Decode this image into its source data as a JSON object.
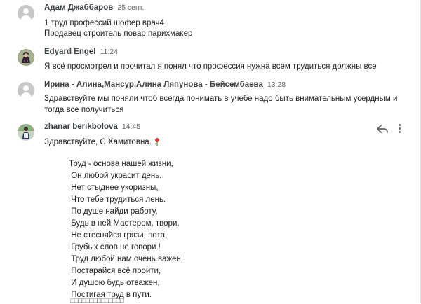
{
  "comments": [
    {
      "author": "Адам Джаббаров",
      "time": "25 сент.",
      "lines": [
        "1 труд профессий шофер врач4",
        "Продавец строитель повар парихмакер"
      ]
    },
    {
      "author": "Edyard Engel",
      "time": "11:24",
      "lines": [
        "Я всё просмотрел и прочитал я понял что профессия нужна всем трудиться должны все"
      ]
    },
    {
      "author": "Ирина - Алина,Мансур,Алина Ляпунова - Бейсембаева",
      "time": "13:28",
      "lines": [
        "Здравствуйте  мы поняли чтоб всегда понимать в учебе надо быть внимательным усердным и",
        "тогда все получиться"
      ]
    },
    {
      "author": "zhanar berikbolova",
      "time": "14:45",
      "greeting": "Здравствуйте, С.Хамитовна.",
      "poem": [
        "Труд - основа нашей жизни,",
        " Он любой украсит день.",
        " Нет стыднее укоризны,",
        " Что тебе трудиться лень.",
        " По душе найди работу,",
        " Будь в ней Мастером, твори,",
        " Не стесняйся грязи, пота,",
        " Грубых слов не говори !",
        " Труд любой нам очень важен,",
        " Постарайся всё пройти,",
        " И душою будь отважен,",
        " Постигая труд в пути.",
        " □□□□□□□□□□□□□□"
      ]
    }
  ],
  "icons": {
    "reply": "reply-icon",
    "more": "more-vert-icon",
    "flower": "rose-emoji-icon"
  },
  "colors": {
    "author": "#3c4043",
    "time": "#5f6368",
    "text": "#202124"
  }
}
